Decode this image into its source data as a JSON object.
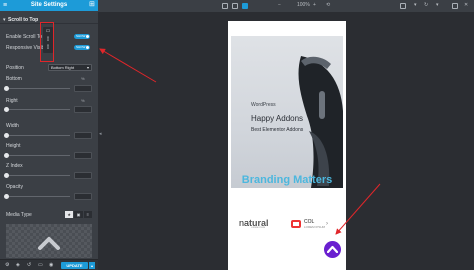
{
  "panel": {
    "title": "Site Settings",
    "section": "Scroll to Top",
    "enable_label": "Enable Scroll To To",
    "enable_value": "SHOW",
    "responsive_label": "Responsive Visibili",
    "responsive_value": "SHOW",
    "position_label": "Position",
    "position_value": "Bottom Right",
    "bottom_label": "Bottom",
    "bottom_unit": "%",
    "right_label": "Right",
    "right_unit": "%",
    "width_label": "Width",
    "height_label": "Height",
    "zindex_label": "Z Index",
    "opacity_label": "Opacity",
    "media_type_label": "Media Type",
    "update_label": "UPDATE"
  },
  "topbar": {
    "zoom": "100%"
  },
  "preview": {
    "hero_small": "WordPress",
    "hero_title": "Happy Addons",
    "hero_sub": "Best Elementor Addons",
    "heading": "Branding Matters",
    "logo1_a": "na",
    "logo1_b": "tural",
    "logo1_tag": "LOREM IPSUM",
    "logo2_text": "COL",
    "logo2_sub": "LOREM IPSUM"
  },
  "colors": {
    "accent": "#1d9bd8",
    "scroll_button": "#6a1fd0",
    "heading": "#4cb7de",
    "annotation": "#e0262a"
  },
  "icons": [
    "hamburger-icon",
    "grid-icon",
    "desktop-icon",
    "tablet-icon",
    "mobile-icon",
    "chevron-up-icon"
  ]
}
